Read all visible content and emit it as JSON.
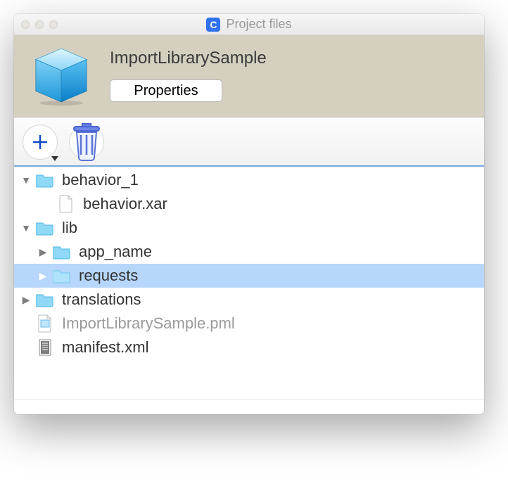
{
  "window": {
    "title": "Project files",
    "app_badge": "C"
  },
  "header": {
    "project_name": "ImportLibrarySample",
    "properties_label": "Properties"
  },
  "tree": {
    "items": [
      {
        "label": "behavior_1",
        "type": "folder",
        "expanded": true,
        "depth": 0
      },
      {
        "label": "behavior.xar",
        "type": "file",
        "depth": 1
      },
      {
        "label": "lib",
        "type": "folder",
        "expanded": true,
        "depth": 0
      },
      {
        "label": "app_name",
        "type": "folder",
        "expanded": false,
        "depth": 1
      },
      {
        "label": "requests",
        "type": "folder",
        "expanded": false,
        "depth": 1,
        "selected": true
      },
      {
        "label": "translations",
        "type": "folder",
        "expanded": false,
        "depth": 0
      },
      {
        "label": "ImportLibrarySample.pml",
        "type": "pml",
        "depth": 0,
        "muted": true
      },
      {
        "label": "manifest.xml",
        "type": "manifest",
        "depth": 0
      }
    ]
  },
  "colors": {
    "accent": "#3f7ff0",
    "selection": "#b6d6fb"
  }
}
